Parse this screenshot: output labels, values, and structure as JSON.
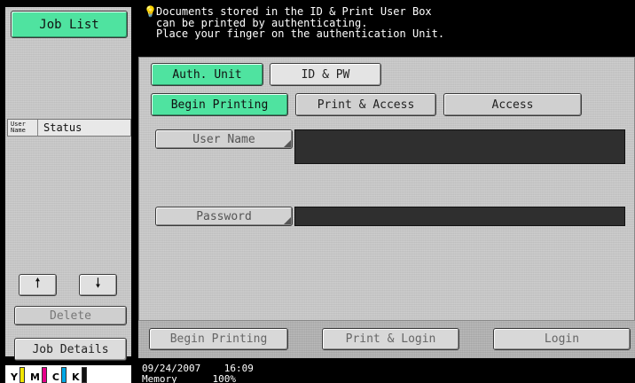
{
  "left_panel": {
    "job_list_label": "Job List",
    "list_header": {
      "user_name": "User Name",
      "status": "Status"
    },
    "up_arrow": "🠕",
    "down_arrow": "🠗",
    "delete_label": "Delete",
    "job_details_label": "Job Details",
    "toner": [
      {
        "letter": "Y",
        "color": "#f2e600"
      },
      {
        "letter": "M",
        "color": "#e6008a"
      },
      {
        "letter": "C",
        "color": "#00a8e6"
      },
      {
        "letter": "K",
        "color": "#111111"
      }
    ]
  },
  "message": {
    "line1": "Documents stored in the ID & Print User Box",
    "line2": "can be printed by authenticating.",
    "line3": "Place your finger on the authentication Unit."
  },
  "auth_mode": {
    "auth_unit_label": "Auth. Unit",
    "id_pw_label": "ID & PW",
    "selected": "Auth. Unit"
  },
  "print_tabs": [
    {
      "label": "Begin Printing",
      "selected": true
    },
    {
      "label": "Print & Access",
      "selected": false
    },
    {
      "label": "Access",
      "selected": false
    }
  ],
  "fields": {
    "user_name_label": "User Name",
    "user_name_value": "",
    "password_label": "Password",
    "password_value": ""
  },
  "bottom_actions": {
    "begin_printing_label": "Begin Printing",
    "print_login_label": "Print & Login",
    "login_label": "Login"
  },
  "status_bar": {
    "date": "09/24/2007",
    "time": "16:09",
    "memory_label": "Memory",
    "memory_value": "100%"
  },
  "colors": {
    "selected_green": "#4fe3a0",
    "panel_grey": "#c9c9c9",
    "field_dark": "#2f2f2f"
  }
}
